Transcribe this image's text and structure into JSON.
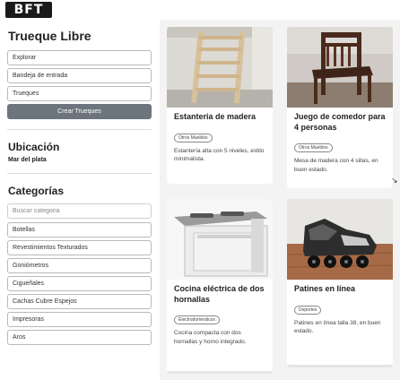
{
  "brand": {
    "logo_text": "BFT"
  },
  "sidebar": {
    "title": "Trueque Libre",
    "nav": [
      {
        "label": "Explorar"
      },
      {
        "label": "Bandeja de entrada"
      },
      {
        "label": "Trueques"
      }
    ],
    "create_button": "Crear Trueques",
    "location_title": "Ubicación",
    "location_value": "Mar del plata",
    "categories_title": "Categorías",
    "category_search_placeholder": "Buscar categoria",
    "categories": [
      {
        "label": "Botellas"
      },
      {
        "label": "Revestimientos Texturados"
      },
      {
        "label": "Goniómetros"
      },
      {
        "label": "Cigueñales"
      },
      {
        "label": "Cachas Cubre Espejos"
      },
      {
        "label": "Impresoras"
      },
      {
        "label": "Aros"
      }
    ]
  },
  "items": [
    {
      "title": "Estanteria de madera",
      "category": "Otros Muebles",
      "description": "Estantería alta con 5 niveles, estilo minimalista.",
      "image_icon": "wooden-shelf-image"
    },
    {
      "title": "Juego de comedor para 4 personas",
      "category": "Otros Muebles",
      "description": "Mesa de madera con 4 sillas, en buen estado.",
      "image_icon": "dining-chair-image"
    },
    {
      "title": "Cocina eléctrica de dos hornallas",
      "category": "Electrodomésticos",
      "description": "Cocina compacta con dos hornallas y horno integrado.",
      "image_icon": "electric-stove-image"
    },
    {
      "title": "Patines en línea",
      "category": "Deportes",
      "description": "Patines en línea talla 38, en buen estado.",
      "image_icon": "inline-skates-image"
    }
  ],
  "colors": {
    "primary_button": "#6c757d",
    "main_background": "#f3f3f3",
    "logo_background": "#1a1a1a"
  }
}
